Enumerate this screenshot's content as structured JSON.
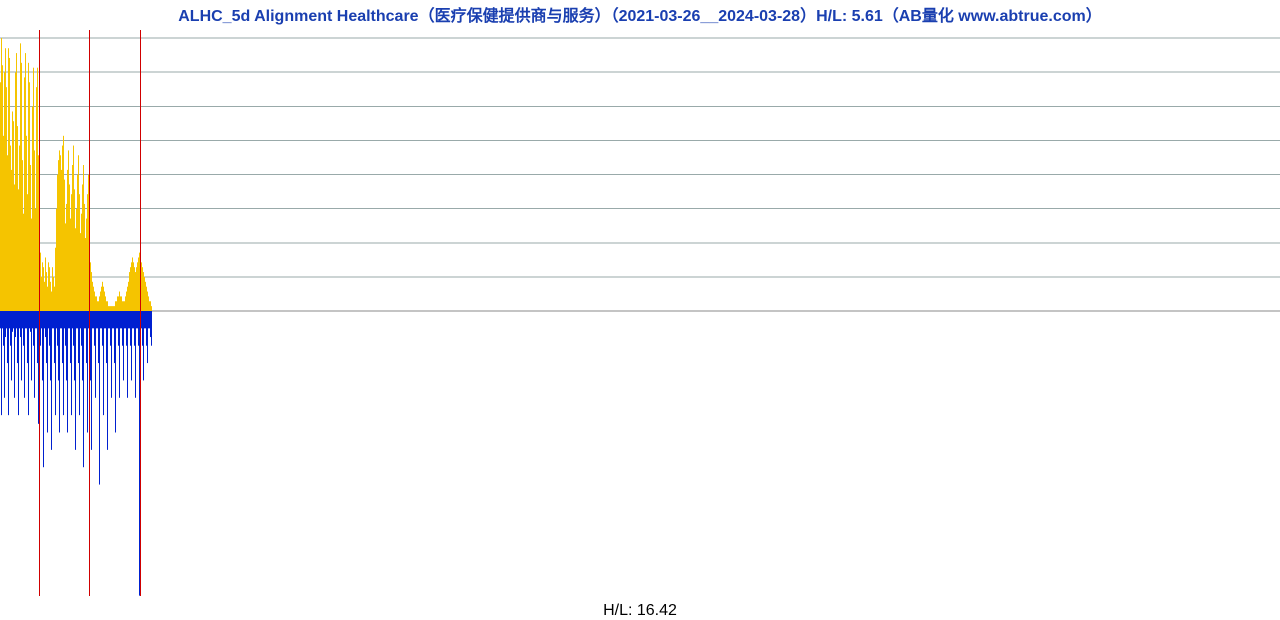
{
  "title": "ALHC_5d Alignment Healthcare（医疗保健提供商与服务）（2021-03-26__2024-03-28）H/L: 5.61（AB量化  www.abtrue.com）",
  "footer": "H/L: 16.42",
  "chart_data": {
    "type": "bar",
    "title": "ALHC_5d Alignment Healthcare（医疗保健提供商与服务）（2021-03-26__2024-03-28）H/L: 5.61（AB量化  www.abtrue.com）",
    "xlabel": "",
    "ylabel": "",
    "x_range_dates": [
      "2021-03-26",
      "2024-03-28"
    ],
    "n_bars": 152,
    "baseline_y": 0,
    "upper_hl": 5.61,
    "lower_hl": 16.42,
    "upper_ylim": [
      0,
      5.61
    ],
    "lower_ylim": [
      -16.42,
      0
    ],
    "grid_lines_upper_count": 9,
    "vertical_markers_index": [
      39,
      89,
      140
    ],
    "series": [
      {
        "name": "upper (yellow, H/L ratio up to 5.61)",
        "color": "#f5c400",
        "values": [
          4.7,
          5.61,
          5.05,
          3.6,
          4.9,
          5.4,
          4.6,
          3.2,
          5.4,
          5.2,
          3.4,
          2.9,
          4.1,
          3.9,
          2.6,
          4.9,
          5.3,
          3.8,
          2.5,
          3.4,
          5.5,
          5.1,
          3.1,
          2.0,
          4.8,
          5.3,
          3.6,
          2.4,
          5.1,
          4.7,
          3.0,
          1.9,
          4.2,
          5.0,
          3.3,
          2.1,
          4.6,
          5.0,
          3.2,
          2.0,
          1.2,
          0.7,
          1.0,
          0.9,
          0.6,
          1.1,
          0.8,
          0.5,
          1.0,
          0.9,
          0.6,
          0.4,
          0.9,
          0.7,
          0.5,
          1.3,
          2.1,
          2.8,
          3.1,
          3.3,
          3.2,
          2.9,
          3.4,
          3.6,
          2.7,
          1.8,
          2.2,
          2.9,
          3.3,
          2.6,
          1.9,
          2.4,
          3.0,
          3.4,
          2.5,
          1.7,
          2.1,
          2.8,
          3.2,
          2.4,
          1.6,
          2.0,
          2.6,
          3.0,
          2.2,
          1.5,
          1.9,
          2.4,
          2.8,
          2.0,
          1.0,
          0.8,
          0.6,
          0.5,
          0.4,
          0.3,
          0.3,
          0.2,
          0.2,
          0.3,
          0.4,
          0.5,
          0.6,
          0.5,
          0.4,
          0.3,
          0.2,
          0.2,
          0.1,
          0.1,
          0.1,
          0.1,
          0.1,
          0.1,
          0.1,
          0.2,
          0.2,
          0.3,
          0.3,
          0.4,
          0.3,
          0.3,
          0.2,
          0.2,
          0.2,
          0.3,
          0.4,
          0.5,
          0.6,
          0.8,
          0.9,
          1.0,
          1.1,
          1.0,
          0.9,
          0.8,
          0.9,
          1.0,
          1.1,
          1.2,
          1.1,
          1.0,
          0.9,
          0.8,
          0.7,
          0.6,
          0.5,
          0.4,
          0.3,
          0.2,
          0.2,
          0.1
        ]
      },
      {
        "name": "lower (blue, H/L ratio down to 16.42, stored as negative depth)",
        "color": "#0020d0",
        "values": [
          -1.0,
          -6.0,
          -1.0,
          -2.0,
          -5.0,
          -1.5,
          -1.0,
          -3.0,
          -6.0,
          -1.0,
          -2.0,
          -4.0,
          -1.2,
          -1.0,
          -5.0,
          -1.5,
          -1.0,
          -3.0,
          -6.0,
          -1.0,
          -1.5,
          -4.0,
          -1.0,
          -2.0,
          -5.0,
          -1.0,
          -1.0,
          -3.0,
          -6.0,
          -1.0,
          -1.2,
          -4.0,
          -1.0,
          -2.0,
          -5.0,
          -1.0,
          -1.0,
          -3.0,
          -6.5,
          -16.0,
          -2.0,
          -1.0,
          -4.0,
          -9.0,
          -1.0,
          -1.5,
          -3.0,
          -7.0,
          -1.0,
          -2.0,
          -4.0,
          -8.0,
          -1.0,
          -1.0,
          -3.0,
          -6.0,
          -1.0,
          -2.0,
          -4.0,
          -7.0,
          -1.0,
          -1.0,
          -3.0,
          -6.0,
          -1.0,
          -2.0,
          -4.0,
          -7.0,
          -1.0,
          -1.0,
          -3.0,
          -6.0,
          -1.0,
          -2.0,
          -4.0,
          -8.0,
          -1.0,
          -1.0,
          -3.0,
          -6.0,
          -1.0,
          -2.0,
          -4.0,
          -9.0,
          -1.0,
          -1.0,
          -3.0,
          -7.0,
          -1.0,
          -15.0,
          -4.0,
          -8.0,
          -1.0,
          -1.0,
          -2.0,
          -5.0,
          -1.0,
          -1.0,
          -3.0,
          -10.0,
          -1.0,
          -1.0,
          -2.0,
          -6.0,
          -1.0,
          -1.0,
          -3.0,
          -8.0,
          -1.0,
          -1.0,
          -2.0,
          -5.0,
          -1.0,
          -1.0,
          -3.0,
          -7.0,
          -1.0,
          -1.0,
          -2.0,
          -5.0,
          -1.0,
          -1.0,
          -2.0,
          -4.0,
          -1.0,
          -1.0,
          -2.0,
          -5.0,
          -1.0,
          -1.0,
          -2.0,
          -4.0,
          -1.0,
          -1.0,
          -2.0,
          -5.0,
          -1.0,
          -1.0,
          -2.0,
          -16.4,
          -1.0,
          -1.0,
          -2.0,
          -4.0,
          -1.0,
          -1.0,
          -2.0,
          -3.0,
          -1.0,
          -1.0,
          -1.5,
          -2.0
        ]
      }
    ]
  }
}
